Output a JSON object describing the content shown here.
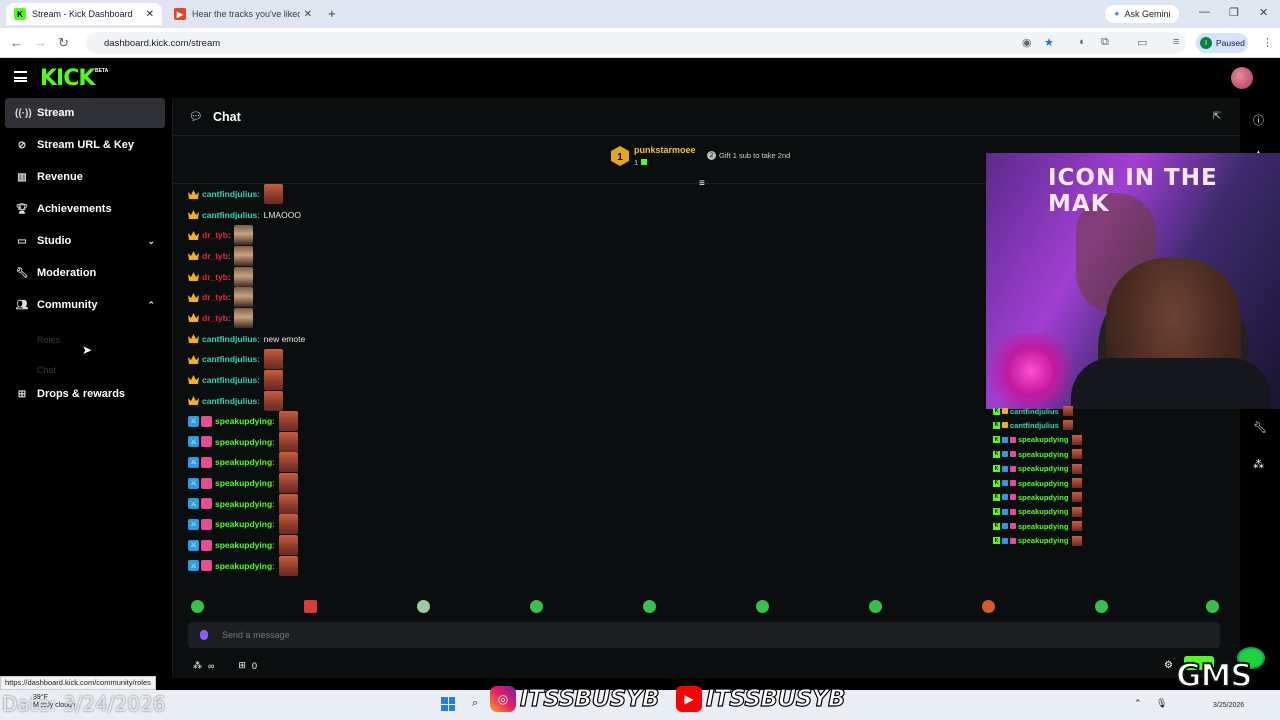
{
  "browser": {
    "tabs": [
      {
        "title": "Stream - Kick Dashboard",
        "active": true
      },
      {
        "title": "Hear the tracks you've liked:",
        "active": false
      }
    ],
    "ask_gemini": "Ask Gemini",
    "url": "dashboard.kick.com/stream",
    "profile_status": "Paused",
    "profile_initial": "I",
    "status_url": "https://dashboard.kick.com/community/roles"
  },
  "app": {
    "logo": "KICK",
    "logo_tag": "BETA"
  },
  "sidebar": {
    "items": [
      {
        "label": "Stream",
        "icon": "stream-icon"
      },
      {
        "label": "Stream URL & Key",
        "icon": "link-icon"
      },
      {
        "label": "Revenue",
        "icon": "chart-icon"
      },
      {
        "label": "Achievements",
        "icon": "trophy-icon"
      },
      {
        "label": "Studio",
        "icon": "monitor-icon"
      },
      {
        "label": "Moderation",
        "icon": "wrench-icon"
      },
      {
        "label": "Community",
        "icon": "people-icon"
      },
      {
        "label": "Drops & rewards",
        "icon": "gift-icon"
      }
    ],
    "community_sub": [
      "Roles",
      "Chat"
    ]
  },
  "chat": {
    "title": "Chat",
    "pinned": {
      "rank": "1",
      "name": "punkstarmoee",
      "count": "1",
      "gift_count": "2",
      "gift_text": "Gift 1 sub to take 2nd"
    },
    "messages": [
      {
        "user": "cantfindjulius",
        "kind": "cfj",
        "text": "",
        "emote": "face"
      },
      {
        "user": "cantfindjulius",
        "kind": "cfj",
        "text": "LMAOOO",
        "emote": ""
      },
      {
        "user": "dr_tyb",
        "kind": "drt",
        "text": "",
        "emote": "man"
      },
      {
        "user": "dr_tyb",
        "kind": "drt",
        "text": "",
        "emote": "man"
      },
      {
        "user": "dr_tyb",
        "kind": "drt",
        "text": "",
        "emote": "man"
      },
      {
        "user": "dr_tyb",
        "kind": "drt",
        "text": "",
        "emote": "man"
      },
      {
        "user": "dr_tyb",
        "kind": "drt",
        "text": "",
        "emote": "man"
      },
      {
        "user": "cantfindjulius",
        "kind": "cfj",
        "text": "new emote",
        "emote": ""
      },
      {
        "user": "cantfindjulius",
        "kind": "cfj",
        "text": "",
        "emote": "face"
      },
      {
        "user": "cantfindjulius",
        "kind": "cfj",
        "text": "",
        "emote": "face"
      },
      {
        "user": "cantfindjulius",
        "kind": "cfj",
        "text": "",
        "emote": "face"
      },
      {
        "user": "speakupdying",
        "kind": "spk",
        "text": "",
        "emote": "face"
      },
      {
        "user": "speakupdying",
        "kind": "spk",
        "text": "",
        "emote": "face"
      },
      {
        "user": "speakupdying",
        "kind": "spk",
        "text": "",
        "emote": "face"
      },
      {
        "user": "speakupdying",
        "kind": "spk",
        "text": "",
        "emote": "face"
      },
      {
        "user": "speakupdying",
        "kind": "spk",
        "text": "",
        "emote": "face"
      },
      {
        "user": "speakupdying",
        "kind": "spk",
        "text": "",
        "emote": "face"
      },
      {
        "user": "speakupdying",
        "kind": "spk",
        "text": "",
        "emote": "face"
      },
      {
        "user": "speakupdying",
        "kind": "spk",
        "text": "",
        "emote": "face"
      }
    ],
    "send_placeholder": "Send a message",
    "footer_infinity": "∞",
    "footer_count": "0"
  },
  "stream_overlay": {
    "banner": "ICON IN THE MAK",
    "chat": [
      {
        "user": "cantfindjulius"
      },
      {
        "user": "cantfindjulius"
      },
      {
        "user": "speakupdying"
      },
      {
        "user": "speakupdying"
      },
      {
        "user": "speakupdying"
      },
      {
        "user": "speakupdying"
      },
      {
        "user": "speakupdying"
      },
      {
        "user": "speakupdying"
      },
      {
        "user": "speakupdying"
      },
      {
        "user": "speakupdying"
      }
    ],
    "social_handle_1": "ITSSBUSYB",
    "social_handle_2": "ITSSBUSYB",
    "date_watermark": "Date: 3/24/2026",
    "corner_logo": "GMS"
  },
  "taskbar": {
    "temperature": "39°F",
    "weather": "Mostly cloudy",
    "date": "3/25/2026"
  },
  "colors": {
    "kick_green": "#53fc18",
    "cantfindjulius": "#26d8b3",
    "dr_tyb": "#e8263c",
    "speakupdying": "#53fc18",
    "pin_gold": "#f1c232"
  }
}
